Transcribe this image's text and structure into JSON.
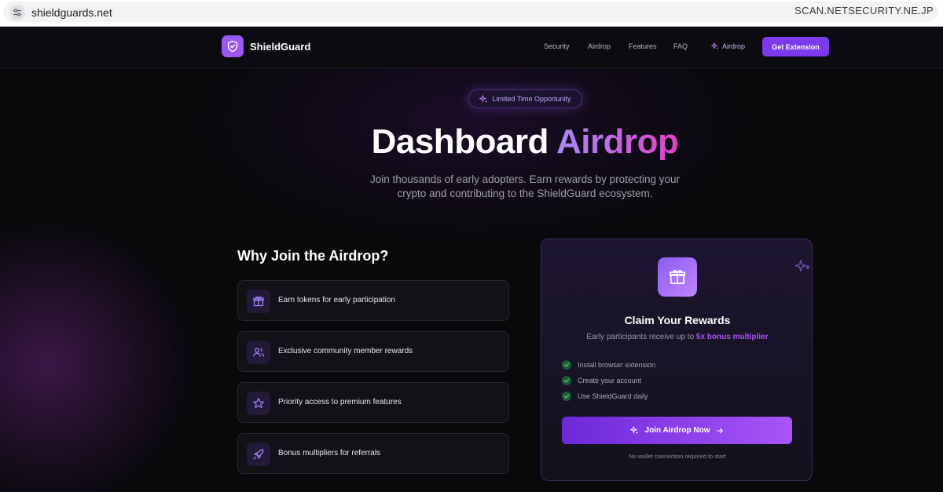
{
  "browser": {
    "url": "shieldguards.net",
    "watermark": "SCAN.NETSECURITY.NE.JP"
  },
  "nav": {
    "brand": "ShieldGuard",
    "links": [
      "Security",
      "Airdrop",
      "Features",
      "FAQ"
    ],
    "airdrop_link": "Airdrop",
    "cta": "Get Extension"
  },
  "hero": {
    "badge": "Limited Time Opportunity",
    "title_part1": "Dashboard",
    "title_part2": "Airdrop",
    "subtitle_line1": "Join thousands of early adopters. Earn rewards by protecting your",
    "subtitle_line2": "crypto and contributing to the ShieldGuard ecosystem."
  },
  "why": {
    "title": "Why Join the Airdrop?",
    "items": [
      {
        "label": "Earn tokens for early participation",
        "icon": "gift-icon"
      },
      {
        "label": "Exclusive community member rewards",
        "icon": "users-icon"
      },
      {
        "label": "Priority access to premium features",
        "icon": "star-icon"
      },
      {
        "label": "Bonus multipliers for referrals",
        "icon": "rocket-icon"
      }
    ]
  },
  "card": {
    "title": "Claim Your Rewards",
    "subtitle_prefix": "Early participants receive up to",
    "subtitle_highlight": "5x bonus multiplier",
    "checklist": [
      "Install browser extension",
      "Create your account",
      "Use ShieldGuard daily"
    ],
    "join_label": "Join Airdrop Now",
    "footnote": "No wallet connection required to start"
  },
  "colors": {
    "accent": "#7c3aed",
    "accent_light": "#a855f7",
    "gradient_end": "#e040c8",
    "check_green": "#22c55e"
  }
}
